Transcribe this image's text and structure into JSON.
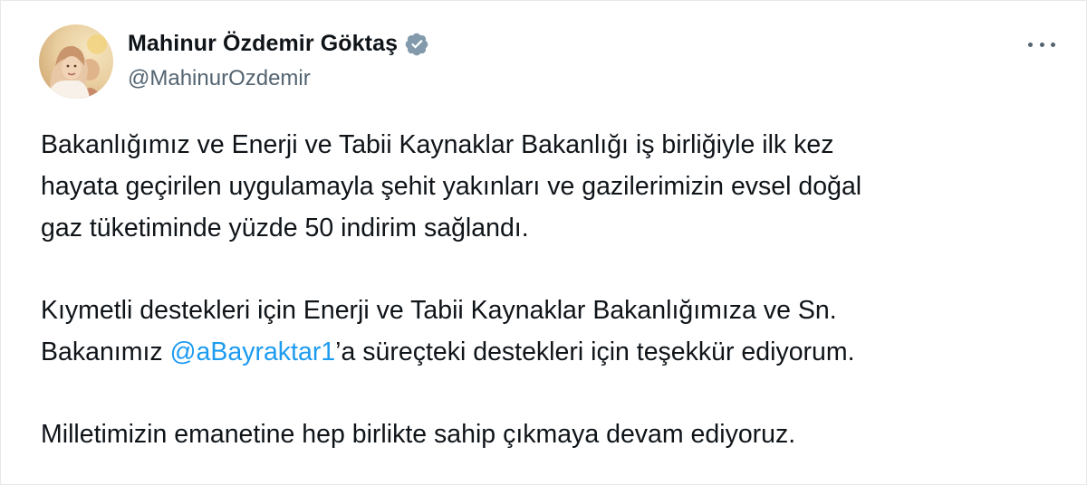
{
  "author": {
    "display_name": "Mahinur Özdemir Göktaş",
    "handle": "@MahinurOzdemir",
    "verified": true,
    "verified_badge_color": "#829aab"
  },
  "avatar_icon": "profile-photo",
  "more_icon": "more-horizontal-icon",
  "tweet": {
    "paragraph1": {
      "line1": "Bakanlığımız ve Enerji ve Tabii Kaynaklar Bakanlığı iş birliğiyle ilk kez",
      "line2": "hayata geçirilen uygulamayla şehit yakınları ve gazilerimizin evsel doğal",
      "line3": "gaz tüketiminde yüzde 50 indirim sağlandı."
    },
    "paragraph2": {
      "line1": "Kıymetli destekleri için Enerji ve Tabii Kaynaklar Bakanlığımıza ve Sn.",
      "line2_prefix": "Bakanımız ",
      "mention": "@aBayraktar1",
      "line2_suffix": "’a süreçteki destekleri için teşekkür ediyorum."
    },
    "paragraph3": {
      "line1": "Milletimizin emanetine hep birlikte sahip çıkmaya devam ediyoruz."
    }
  },
  "colors": {
    "text": "#0f1419",
    "secondary": "#536471",
    "link": "#1d9bf0"
  }
}
